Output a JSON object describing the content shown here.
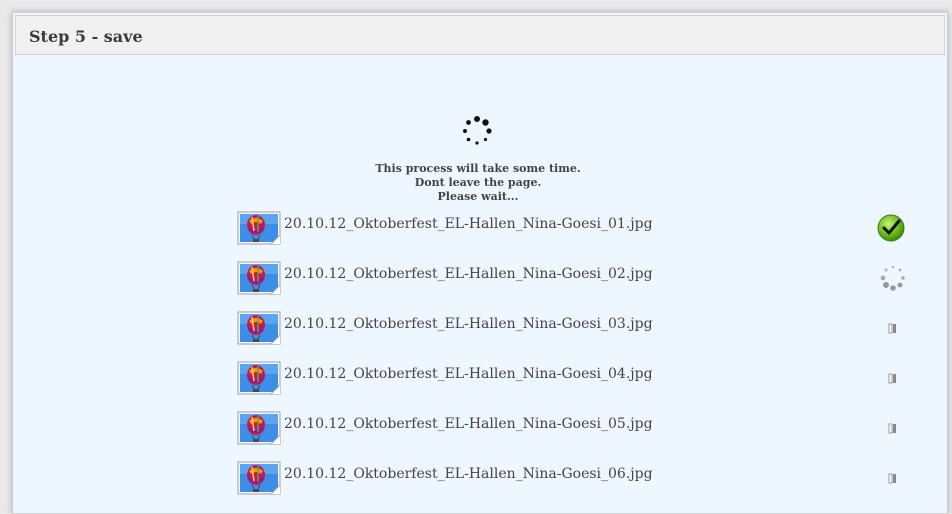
{
  "panel": {
    "title": "Step 5 - save"
  },
  "progress": {
    "line1": "This process will take some time.",
    "line2": "Dont leave the page.",
    "line3": "Please wait..."
  },
  "files": [
    {
      "name": "20.10.12_Oktoberfest_EL-Hallen_Nina-Goesi_01.jpg",
      "status": "done",
      "status_icon": "checkmark-icon"
    },
    {
      "name": "20.10.12_Oktoberfest_EL-Hallen_Nina-Goesi_02.jpg",
      "status": "uploading",
      "status_icon": "spinner-icon"
    },
    {
      "name": "20.10.12_Oktoberfest_EL-Hallen_Nina-Goesi_03.jpg",
      "status": "queued",
      "status_icon": "pending-icon"
    },
    {
      "name": "20.10.12_Oktoberfest_EL-Hallen_Nina-Goesi_04.jpg",
      "status": "queued",
      "status_icon": "pending-icon"
    },
    {
      "name": "20.10.12_Oktoberfest_EL-Hallen_Nina-Goesi_05.jpg",
      "status": "queued",
      "status_icon": "pending-icon"
    },
    {
      "name": "20.10.12_Oktoberfest_EL-Hallen_Nina-Goesi_06.jpg",
      "status": "queued",
      "status_icon": "pending-icon"
    }
  ],
  "colors": {
    "panel_bg": "#eef6ff",
    "header_bg": "#f0f0f0",
    "success": "#6fbf1e"
  }
}
